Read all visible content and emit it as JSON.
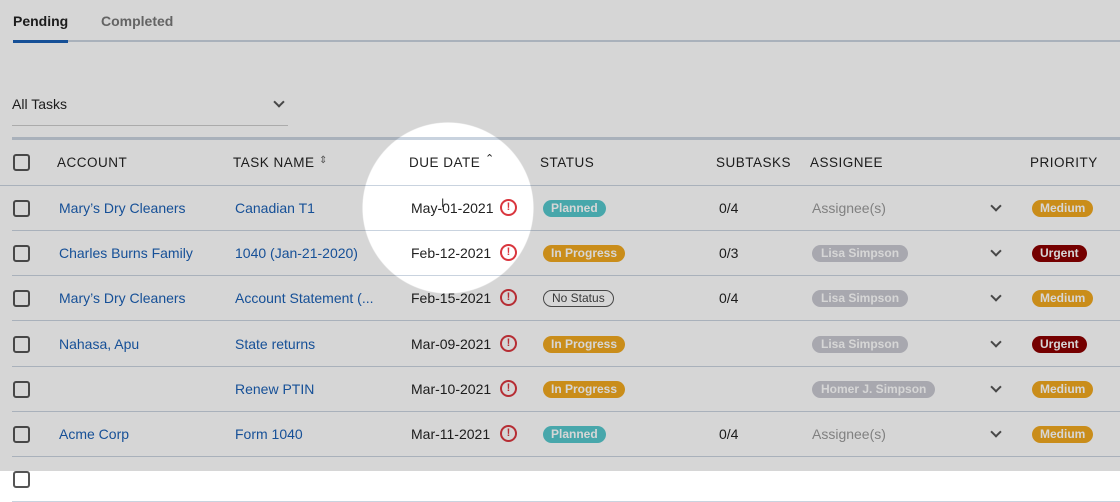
{
  "tabs": [
    {
      "label": "Pending",
      "active": true
    },
    {
      "label": "Completed",
      "active": false
    }
  ],
  "filter": {
    "value": "All Tasks"
  },
  "columns": {
    "account": "ACCOUNT",
    "task_name": "TASK NAME",
    "due_date": "DUE DATE",
    "status": "STATUS",
    "subtasks": "SUBTASKS",
    "assignee": "ASSIGNEE",
    "priority": "PRIORITY"
  },
  "rows": [
    {
      "account": "Mary’s Dry Cleaners",
      "task": "Canadian T1",
      "due": "May-01-2021",
      "status": "Planned",
      "subtasks": "0/4",
      "assignee": "Assignee(s)",
      "assignee_placeholder": true,
      "priority": "Medium"
    },
    {
      "account": "Charles Burns Family",
      "task": "1040 (Jan-21-2020)",
      "due": "Feb-12-2021",
      "status": "In Progress",
      "subtasks": "0/3",
      "assignee": "Lisa Simpson",
      "priority": "Urgent"
    },
    {
      "account": "Mary’s Dry Cleaners",
      "task": "Account Statement (...",
      "due": "Feb-15-2021",
      "status": "No Status",
      "subtasks": "0/4",
      "assignee": "Lisa Simpson",
      "priority": "Medium"
    },
    {
      "account": "Nahasa, Apu",
      "task": "State returns",
      "due": "Mar-09-2021",
      "status": "In Progress",
      "subtasks": "",
      "assignee": "Lisa Simpson",
      "priority": "Urgent"
    },
    {
      "account": "",
      "task": "Renew PTIN",
      "due": "Mar-10-2021",
      "status": "In Progress",
      "subtasks": "",
      "assignee": "Homer J. Simpson",
      "priority": "Medium"
    },
    {
      "account": "Acme Corp",
      "task": "Form 1040",
      "due": "Mar-11-2021",
      "status": "Planned",
      "subtasks": "0/4",
      "assignee": "Assignee(s)",
      "assignee_placeholder": true,
      "priority": "Medium"
    }
  ]
}
